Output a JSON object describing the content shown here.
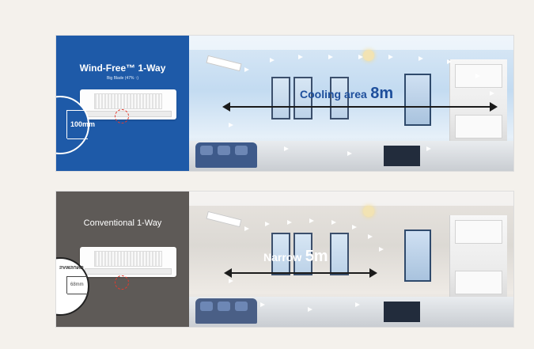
{
  "top_panel": {
    "product_title": "Wind-Free™ 1-Way",
    "product_subtitle": "Big Blade (47% ↑)",
    "dimension": "100mm",
    "area_word": "Cooling  area",
    "area_value": "8m"
  },
  "bottom_panel": {
    "product_title": "Conventional 1-Way",
    "brand_mirrored": "SAMSUNG",
    "dimension": "68mm",
    "area_word": "Narrow",
    "area_value": "5m"
  },
  "colors": {
    "wind_free_blue": "#1e5aa8",
    "conventional_gray": "#5e5a57",
    "highlight_red": "#e33b2f"
  }
}
